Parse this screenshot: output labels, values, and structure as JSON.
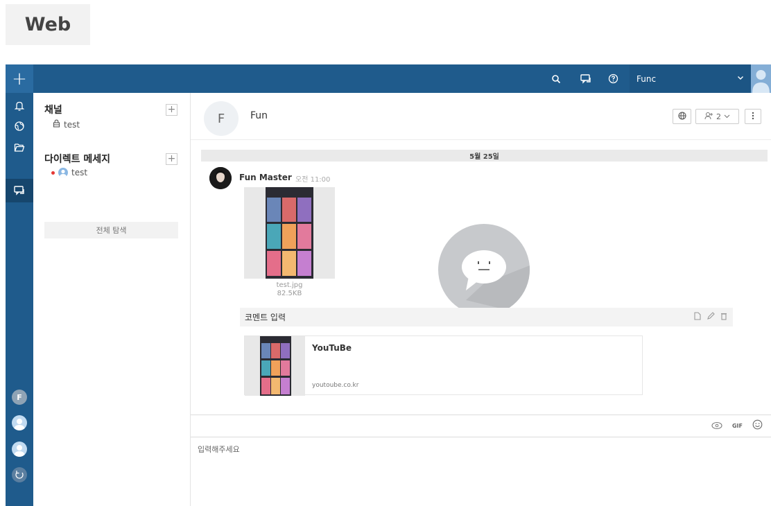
{
  "label": "Web",
  "topbar": {
    "workspace": "Func"
  },
  "sidebar": {
    "channels_title": "채널",
    "channels": [
      {
        "name": "test"
      }
    ],
    "dm_title": "다이렉트 메세지",
    "dms": [
      {
        "name": "test",
        "status": "offline"
      }
    ],
    "search_all": "전체 탐색"
  },
  "rail": {
    "avatars": [
      {
        "initial": "F"
      }
    ]
  },
  "channel": {
    "initial": "F",
    "name": "Fun",
    "member_count": "2"
  },
  "feed": {
    "date": "5월 25일",
    "message": {
      "author": "Fun Master",
      "time": "오전 11:00",
      "file": {
        "name": "test.jpg",
        "size": "82.5KB"
      }
    },
    "comment_label": "코멘트 입력",
    "link_preview": {
      "title": "YouTuBe",
      "url": "youtoube.co.kr"
    }
  },
  "composer": {
    "gif_label": "GIF",
    "placeholder": "입력해주세요"
  },
  "colors": {
    "primary": "#1f5b8c",
    "status_dot": "#e53935"
  }
}
